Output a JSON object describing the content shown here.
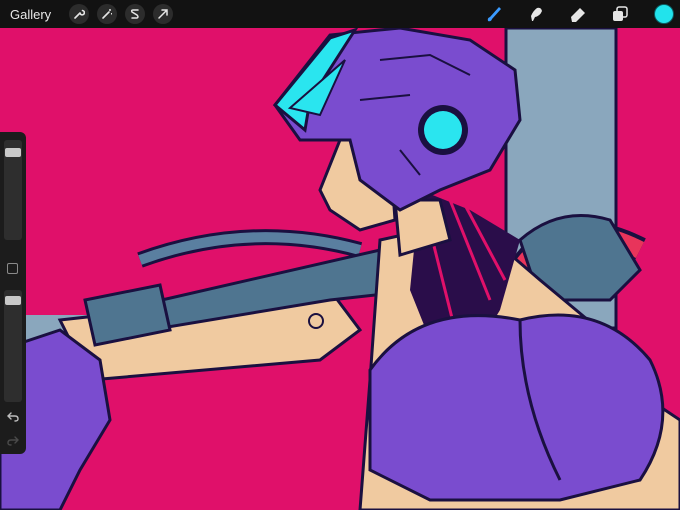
{
  "topbar": {
    "gallery_label": "Gallery",
    "left_tools": [
      {
        "icon": "wrench-icon"
      },
      {
        "icon": "magic-wand-icon"
      },
      {
        "icon": "selection-icon"
      },
      {
        "icon": "transform-arrow-icon"
      }
    ],
    "right_tools": [
      {
        "icon": "brush-icon",
        "active": true
      },
      {
        "icon": "smudge-icon"
      },
      {
        "icon": "eraser-icon"
      },
      {
        "icon": "layers-icon"
      }
    ],
    "current_color": "#22e3ec"
  },
  "sidebar": {
    "brush_size": 0.92,
    "opacity": 0.95,
    "undo_icon": "undo-icon",
    "redo_icon": "redo-icon"
  },
  "colors": {
    "background": "#e0106a",
    "armor_purple": "#7a4ccf",
    "skin": "#f0caa0",
    "cyan": "#2ae5ef",
    "steel": "#4f7590",
    "panel_blue": "#8aa7bd"
  }
}
